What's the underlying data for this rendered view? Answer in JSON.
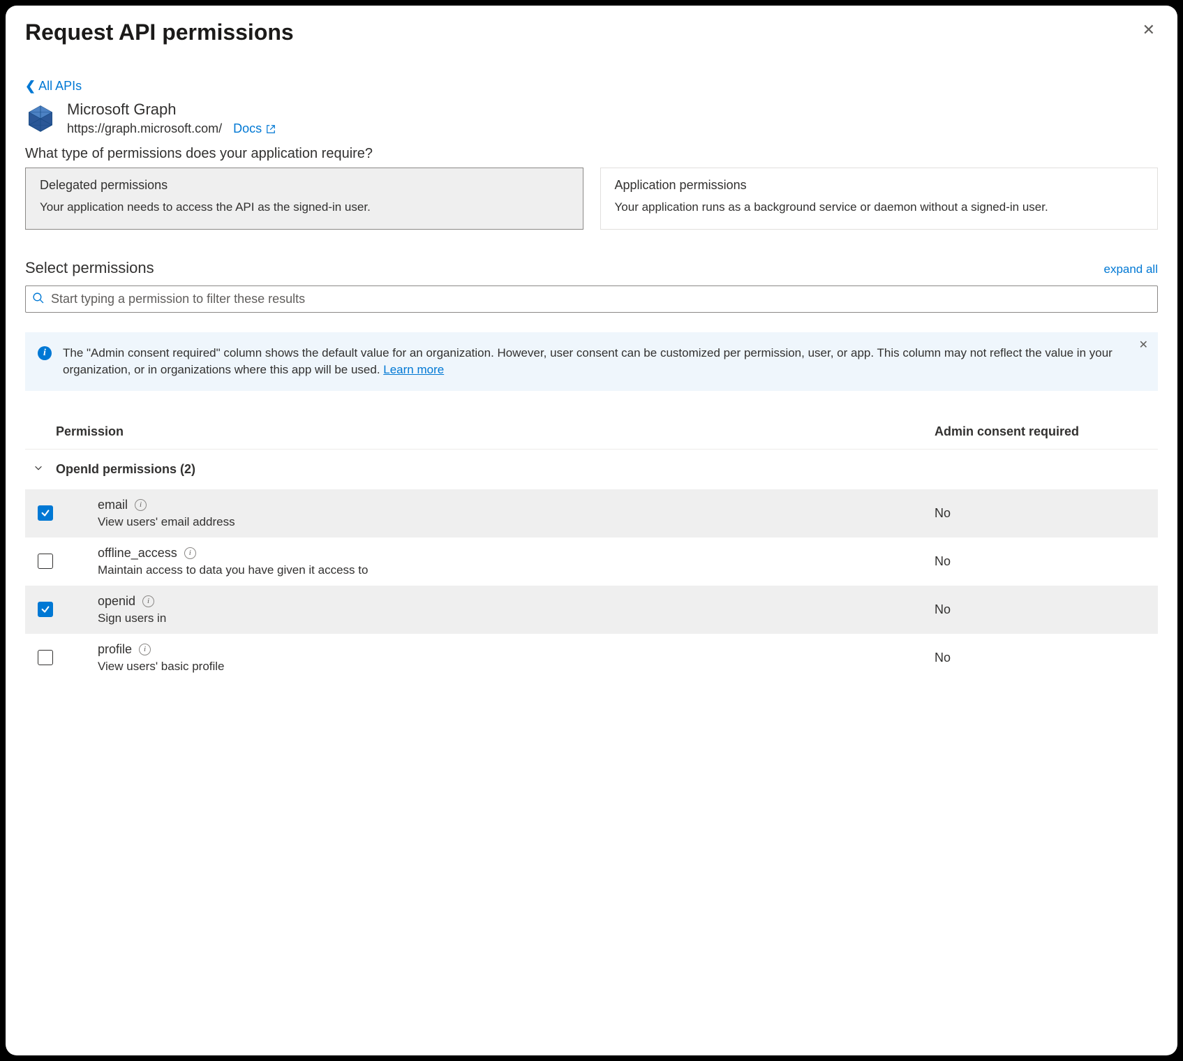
{
  "title": "Request API permissions",
  "back_link": "All APIs",
  "api": {
    "name": "Microsoft Graph",
    "url": "https://graph.microsoft.com/",
    "docs_label": "Docs"
  },
  "type_question": "What type of permissions does your application require?",
  "cards": {
    "delegated": {
      "title": "Delegated permissions",
      "desc": "Your application needs to access the API as the signed-in user."
    },
    "application": {
      "title": "Application permissions",
      "desc": "Your application runs as a background service or daemon without a signed-in user."
    }
  },
  "select_label": "Select permissions",
  "expand_label": "expand all",
  "search_placeholder": "Start typing a permission to filter these results",
  "info": {
    "text_a": "The \"Admin consent required\" column shows the default value for an organization. However, user consent can be customized per permission, user, or app. This column may not reflect the value in your organization, or in organizations where this app will be used.  ",
    "link": "Learn more"
  },
  "columns": {
    "permission": "Permission",
    "admin": "Admin consent required"
  },
  "group": {
    "label": "OpenId permissions (2)"
  },
  "perms": [
    {
      "name": "email",
      "desc": "View users' email address",
      "admin": "No",
      "checked": true
    },
    {
      "name": "offline_access",
      "desc": "Maintain access to data you have given it access to",
      "admin": "No",
      "checked": false
    },
    {
      "name": "openid",
      "desc": "Sign users in",
      "admin": "No",
      "checked": true
    },
    {
      "name": "profile",
      "desc": "View users' basic profile",
      "admin": "No",
      "checked": false
    }
  ]
}
